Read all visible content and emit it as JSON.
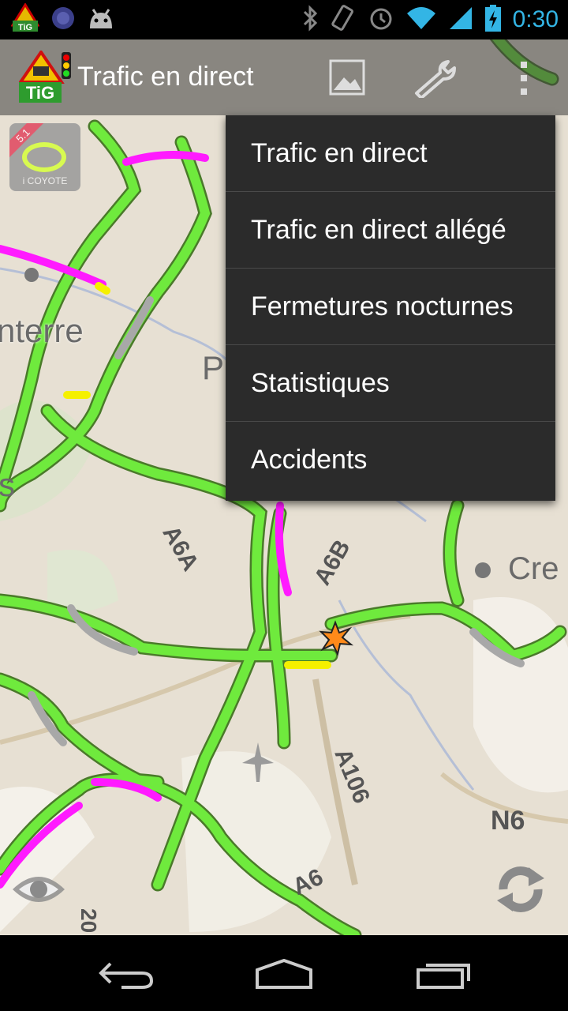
{
  "status_bar": {
    "time": "0:30",
    "notification_icons": [
      "tig-app-icon",
      "circle-notification-icon",
      "android-debug-icon"
    ],
    "system_icons": [
      "bluetooth-icon",
      "rotation-icon",
      "alarm-icon",
      "wifi-icon",
      "signal-icon",
      "battery-charging-icon"
    ]
  },
  "action_bar": {
    "app_icon_label": "TiG",
    "title": "Trafic en direct",
    "actions": [
      "image-icon",
      "wrench-icon",
      "overflow-menu-icon"
    ]
  },
  "map": {
    "coyote_badge": {
      "version": "5.1",
      "label": "i COYOTE"
    },
    "labels": [
      "nterre",
      "P",
      "s",
      "A6A",
      "A6B",
      "Cre",
      "A106",
      "N6",
      "A6",
      "20"
    ],
    "accent_colors": {
      "free_flow": "#6fea3d",
      "congested": "#ff1aff",
      "slow": "#f5f000",
      "no_data": "#a8a8a8"
    }
  },
  "overflow_menu": {
    "items": [
      "Trafic en direct",
      "Trafic en direct allégé",
      "Fermetures nocturnes",
      "Statistiques",
      "Accidents"
    ]
  },
  "map_controls": [
    "eye-icon",
    "refresh-icon"
  ],
  "nav_bar": [
    "back-icon",
    "home-icon",
    "recent-apps-icon"
  ]
}
